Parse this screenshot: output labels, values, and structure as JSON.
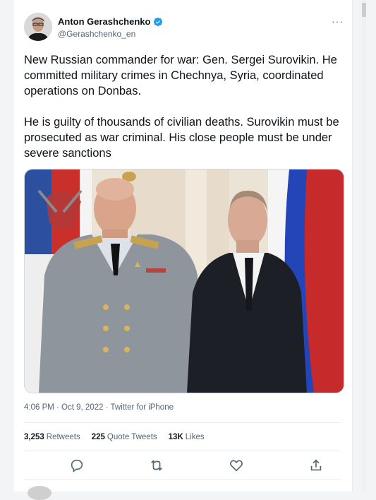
{
  "tweet": {
    "author_name": "Anton Gerashchenko",
    "author_handle": "@Gerashchenko_en",
    "verified_icon": "verified-badge-icon",
    "text": "New Russian commander for war: Gen. Sergei Surovikin. He committed military crimes in Chechnya, Syria, coordinated operations on Donbas.\n\nHe is guilty of thousands of civilian deaths. Surovikin must be prosecuted as war criminal. His close people must be under severe sanctions",
    "timestamp": "4:06 PM · Oct 9, 2022 · Twitter for iPhone",
    "stats": {
      "retweets_count": "3,253",
      "retweets_label": "Retweets",
      "quotes_count": "225",
      "quotes_label": "Quote Tweets",
      "likes_count": "13K",
      "likes_label": "Likes"
    },
    "actions": [
      "reply-icon",
      "retweet-icon",
      "like-icon",
      "share-icon"
    ]
  },
  "colors": {
    "accent": "#1d9bf0",
    "secondary_text": "#536471",
    "primary_text": "#0f1419"
  }
}
